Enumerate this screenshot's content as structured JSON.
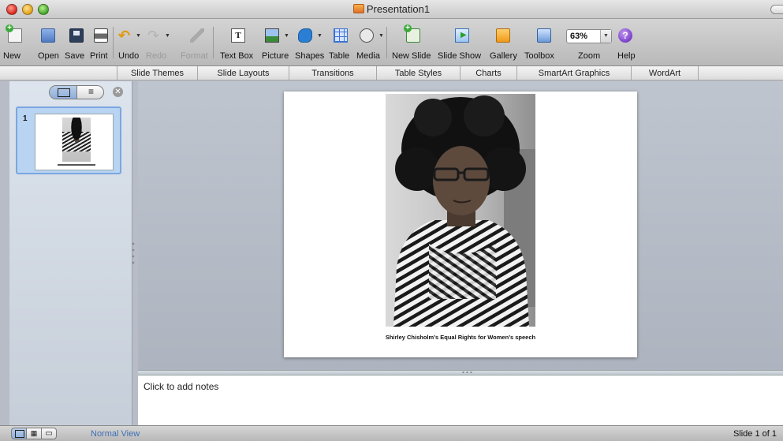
{
  "window": {
    "title": "Presentation1"
  },
  "toolbar": {
    "new": "New",
    "open": "Open",
    "save": "Save",
    "print": "Print",
    "undo": "Undo",
    "redo": "Redo",
    "format": "Format",
    "text_box": "Text Box",
    "picture": "Picture",
    "shapes": "Shapes",
    "table": "Table",
    "media": "Media",
    "new_slide": "New Slide",
    "slide_show": "Slide Show",
    "gallery": "Gallery",
    "toolbox": "Toolbox",
    "zoom": "Zoom",
    "zoom_value": "63%",
    "help": "Help"
  },
  "ribbon": {
    "tabs": [
      "Slide Themes",
      "Slide Layouts",
      "Transitions",
      "Table Styles",
      "Charts",
      "SmartArt Graphics",
      "WordArt"
    ]
  },
  "panel": {
    "slide_number": "1",
    "outline_glyph": "≡",
    "close_glyph": "✕"
  },
  "slide": {
    "caption": "Shirley Chisholm’s Equal Rights for Women’s speech"
  },
  "notes": {
    "placeholder": "Click to add notes"
  },
  "status": {
    "view_label": "Normal View",
    "slide_counter": "Slide 1 of 1"
  }
}
